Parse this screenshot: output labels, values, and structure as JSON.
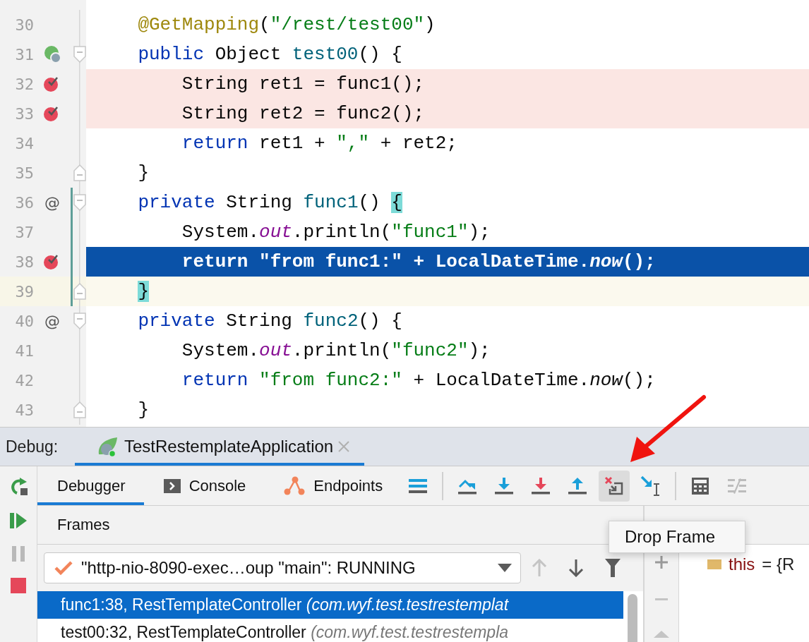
{
  "editor": {
    "lines": [
      {
        "number": "30",
        "breakpoint": false,
        "execution_point": false,
        "caret_line": false,
        "changed": false,
        "tokens": [
          {
            "kind": "annotation",
            "text": "    @GetMapping"
          },
          {
            "kind": "plain",
            "text": "("
          },
          {
            "kind": "string",
            "text": "\"/rest/test00\""
          },
          {
            "kind": "plain",
            "text": ")"
          }
        ]
      },
      {
        "number": "31",
        "gutter_icon": {
          "kind": "endpoint"
        },
        "fold": {
          "kind": "start"
        },
        "breakpoint": false,
        "execution_point": false,
        "caret_line": false,
        "changed": false,
        "tokens": [
          {
            "kind": "keyword",
            "text": "    public"
          },
          {
            "kind": "plain",
            "text": " Object "
          },
          {
            "kind": "method",
            "text": "test00"
          },
          {
            "kind": "plain",
            "text": "() {"
          }
        ]
      },
      {
        "number": "32",
        "breakpoint": true,
        "execution_point": false,
        "caret_line": false,
        "changed": false,
        "tokens": [
          {
            "kind": "plain",
            "text": "        String ret1 = func1();"
          }
        ]
      },
      {
        "number": "33",
        "breakpoint": true,
        "execution_point": false,
        "caret_line": false,
        "changed": false,
        "tokens": [
          {
            "kind": "plain",
            "text": "        String ret2 = func2();"
          }
        ]
      },
      {
        "number": "34",
        "breakpoint": false,
        "execution_point": false,
        "caret_line": false,
        "changed": false,
        "tokens": [
          {
            "kind": "keyword",
            "text": "        return"
          },
          {
            "kind": "plain",
            "text": " ret1 + "
          },
          {
            "kind": "string",
            "text": "\",\""
          },
          {
            "kind": "plain",
            "text": " + ret2;"
          }
        ]
      },
      {
        "number": "35",
        "fold": {
          "kind": "end"
        },
        "breakpoint": false,
        "execution_point": false,
        "caret_line": false,
        "changed": false,
        "tokens": [
          {
            "kind": "plain",
            "text": "    }"
          }
        ]
      },
      {
        "number": "36",
        "gutter_text": "@",
        "fold": {
          "kind": "start"
        },
        "breakpoint": false,
        "execution_point": false,
        "caret_line": false,
        "changed": true,
        "tokens": [
          {
            "kind": "keyword",
            "text": "    private"
          },
          {
            "kind": "plain",
            "text": " String "
          },
          {
            "kind": "method",
            "text": "func1"
          },
          {
            "kind": "plain",
            "text": "() "
          },
          {
            "kind": "brace",
            "text": "{"
          }
        ]
      },
      {
        "number": "37",
        "breakpoint": false,
        "execution_point": false,
        "caret_line": false,
        "changed": true,
        "tokens": [
          {
            "kind": "plain",
            "text": "        System."
          },
          {
            "kind": "field",
            "text": "out"
          },
          {
            "kind": "plain",
            "text": ".println("
          },
          {
            "kind": "string",
            "text": "\"func1\""
          },
          {
            "kind": "plain",
            "text": ");"
          }
        ]
      },
      {
        "number": "38",
        "breakpoint": true,
        "execution_point": true,
        "caret_line": false,
        "changed": true,
        "tokens": [
          {
            "kind": "keyword",
            "text": "        return"
          },
          {
            "kind": "string",
            "text": " \"from func1:\""
          },
          {
            "kind": "plain",
            "text": " + LocalDateTime."
          },
          {
            "kind": "static",
            "text": "now"
          },
          {
            "kind": "plain",
            "text": "();"
          }
        ]
      },
      {
        "number": "39",
        "fold": {
          "kind": "end"
        },
        "breakpoint": false,
        "execution_point": false,
        "caret_line": true,
        "changed": true,
        "tokens": [
          {
            "kind": "brace",
            "text": "    }"
          }
        ]
      },
      {
        "number": "40",
        "gutter_text": "@",
        "fold": {
          "kind": "start"
        },
        "breakpoint": false,
        "execution_point": false,
        "caret_line": false,
        "changed": false,
        "tokens": [
          {
            "kind": "keyword",
            "text": "    private"
          },
          {
            "kind": "plain",
            "text": " String "
          },
          {
            "kind": "method",
            "text": "func2"
          },
          {
            "kind": "plain",
            "text": "() {"
          }
        ]
      },
      {
        "number": "41",
        "breakpoint": false,
        "execution_point": false,
        "caret_line": false,
        "changed": false,
        "tokens": [
          {
            "kind": "plain",
            "text": "        System."
          },
          {
            "kind": "field",
            "text": "out"
          },
          {
            "kind": "plain",
            "text": ".println("
          },
          {
            "kind": "string",
            "text": "\"func2\""
          },
          {
            "kind": "plain",
            "text": ");"
          }
        ]
      },
      {
        "number": "42",
        "breakpoint": false,
        "execution_point": false,
        "caret_line": false,
        "changed": false,
        "tokens": [
          {
            "kind": "keyword",
            "text": "        return"
          },
          {
            "kind": "string",
            "text": " \"from func2:\""
          },
          {
            "kind": "plain",
            "text": " + LocalDateTime."
          },
          {
            "kind": "static",
            "text": "now"
          },
          {
            "kind": "plain",
            "text": "();"
          }
        ]
      },
      {
        "number": "43",
        "fold": {
          "kind": "end"
        },
        "breakpoint": false,
        "execution_point": false,
        "caret_line": false,
        "changed": false,
        "tokens": [
          {
            "kind": "plain",
            "text": "    }"
          }
        ]
      }
    ]
  },
  "debug": {
    "label": "Debug:",
    "session_tab": {
      "title": "TestRestemplateApplication",
      "selected": true
    },
    "side_toolbar": [
      {
        "kind": "rerun",
        "disabled": false
      },
      {
        "kind": "resume",
        "disabled": false
      },
      {
        "kind": "pause",
        "disabled": true
      },
      {
        "kind": "stop",
        "disabled": false
      }
    ],
    "tabs": [
      {
        "kind": "debugger",
        "label": "Debugger",
        "selected": true
      },
      {
        "kind": "console",
        "label": "Console",
        "selected": false
      },
      {
        "kind": "endpoints",
        "label": "Endpoints",
        "selected": false
      }
    ],
    "toolbar_groups": [
      [
        {
          "kind": "layout",
          "hovered": false,
          "disabled": false
        }
      ],
      [
        {
          "kind": "step-over",
          "hovered": false,
          "disabled": false
        },
        {
          "kind": "step-into",
          "hovered": false,
          "disabled": false
        },
        {
          "kind": "force-step-into",
          "hovered": false,
          "disabled": false
        },
        {
          "kind": "step-out",
          "hovered": false,
          "disabled": false
        },
        {
          "kind": "drop-frame",
          "hovered": true,
          "disabled": false
        },
        {
          "kind": "run-to-cursor",
          "hovered": false,
          "disabled": false
        }
      ],
      [
        {
          "kind": "evaluate",
          "hovered": false,
          "disabled": false
        },
        {
          "kind": "trace",
          "hovered": false,
          "disabled": true
        }
      ]
    ],
    "frames": {
      "title": "Frames",
      "thread": {
        "value": "\"http-nio-8090-exec…oup \"main\": RUNNING"
      },
      "nav": [
        {
          "kind": "up",
          "disabled": true
        },
        {
          "kind": "down",
          "disabled": false
        },
        {
          "kind": "filter",
          "disabled": false
        }
      ],
      "rows": [
        {
          "text": "func1:38, RestTemplateController *(com.wyf.test.testrestemplat*",
          "selected": true
        },
        {
          "text": "test00:32, RestTemplateController *(com.wyf.test.testrestempla*",
          "selected": false
        }
      ]
    },
    "variables": {
      "side_buttons": [
        {
          "kind": "add"
        },
        {
          "kind": "remove"
        },
        {
          "kind": "up"
        }
      ],
      "rows": [
        {
          "name": "this",
          "value": "= {R"
        }
      ]
    },
    "tooltip": {
      "text": "Drop Frame"
    },
    "callout_arrow": true
  }
}
